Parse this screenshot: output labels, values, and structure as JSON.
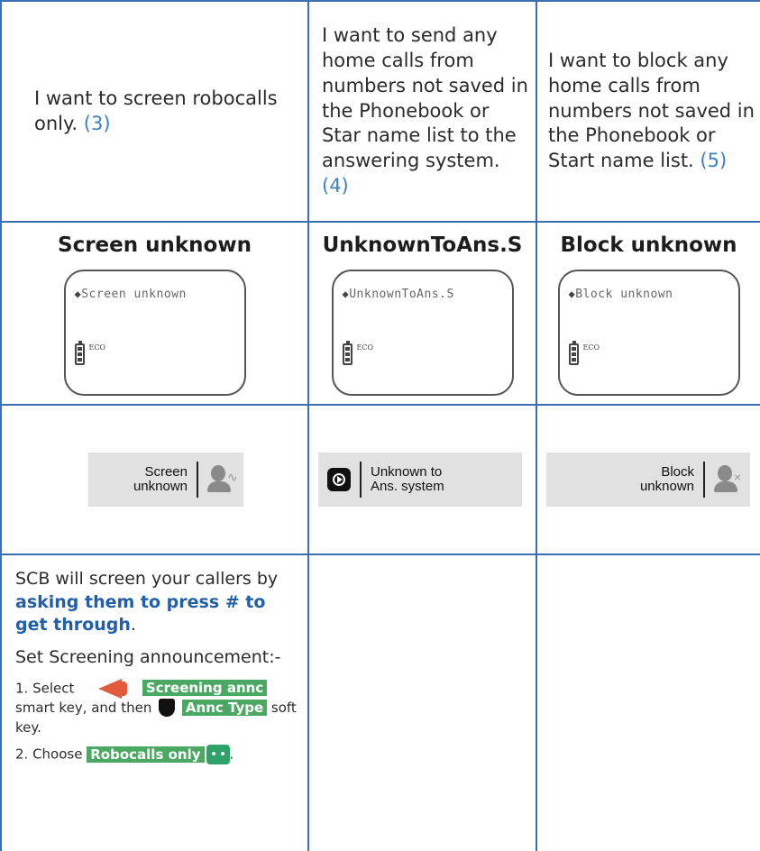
{
  "intro": {
    "col1": {
      "text": "I want to screen robocalls only.",
      "ref": "(3)"
    },
    "col2": {
      "text": "I want to send any home calls from numbers not saved in the Phonebook or Star name list to the answering system.",
      "ref": "(4)"
    },
    "col3": {
      "text": "I want to block any home calls from numbers not saved in the Phonebook or Start name list.",
      "ref": "(5)"
    }
  },
  "headings": {
    "col1": "Screen unknown",
    "col2": "UnknownToAns.S",
    "col3": "Block unknown"
  },
  "lcd": {
    "col1": {
      "arrow": "◆",
      "text": "Screen unknown",
      "eco": "ECO"
    },
    "col2": {
      "arrow": "◆",
      "text": "UnknownToAns.S",
      "eco": "ECO"
    },
    "col3": {
      "arrow": "◆",
      "text": "Block unknown",
      "eco": "ECO"
    }
  },
  "softkeys": {
    "col1": {
      "line1": "Screen",
      "line2": "unknown",
      "icon": "screen-unknown-person-icon"
    },
    "col2": {
      "line1": "Unknown to",
      "line2": "Ans. system",
      "icon": "play-icon"
    },
    "col3": {
      "line1": "Block",
      "line2": "unknown",
      "icon": "block-unknown-person-icon"
    }
  },
  "description": {
    "para1_start": "SCB will screen your callers by ",
    "para1_bold": "asking them to press # to get through",
    "para1_end": ".",
    "para2": "Set Screening announcement:-",
    "step1_a": "1. Select",
    "step1_tag1": "Screening annc",
    "step1_b": "smart key, and then",
    "step1_tag2": "Annc Type",
    "step1_c": "soft key.",
    "step2_a": "2. Choose",
    "step2_tag": "Robocalls only",
    "step2_b": "."
  },
  "colors": {
    "border": "#3a6fb0",
    "ref": "#3b7fc6",
    "bold_blue": "#215fa8",
    "tag_green": "#4aa862"
  }
}
